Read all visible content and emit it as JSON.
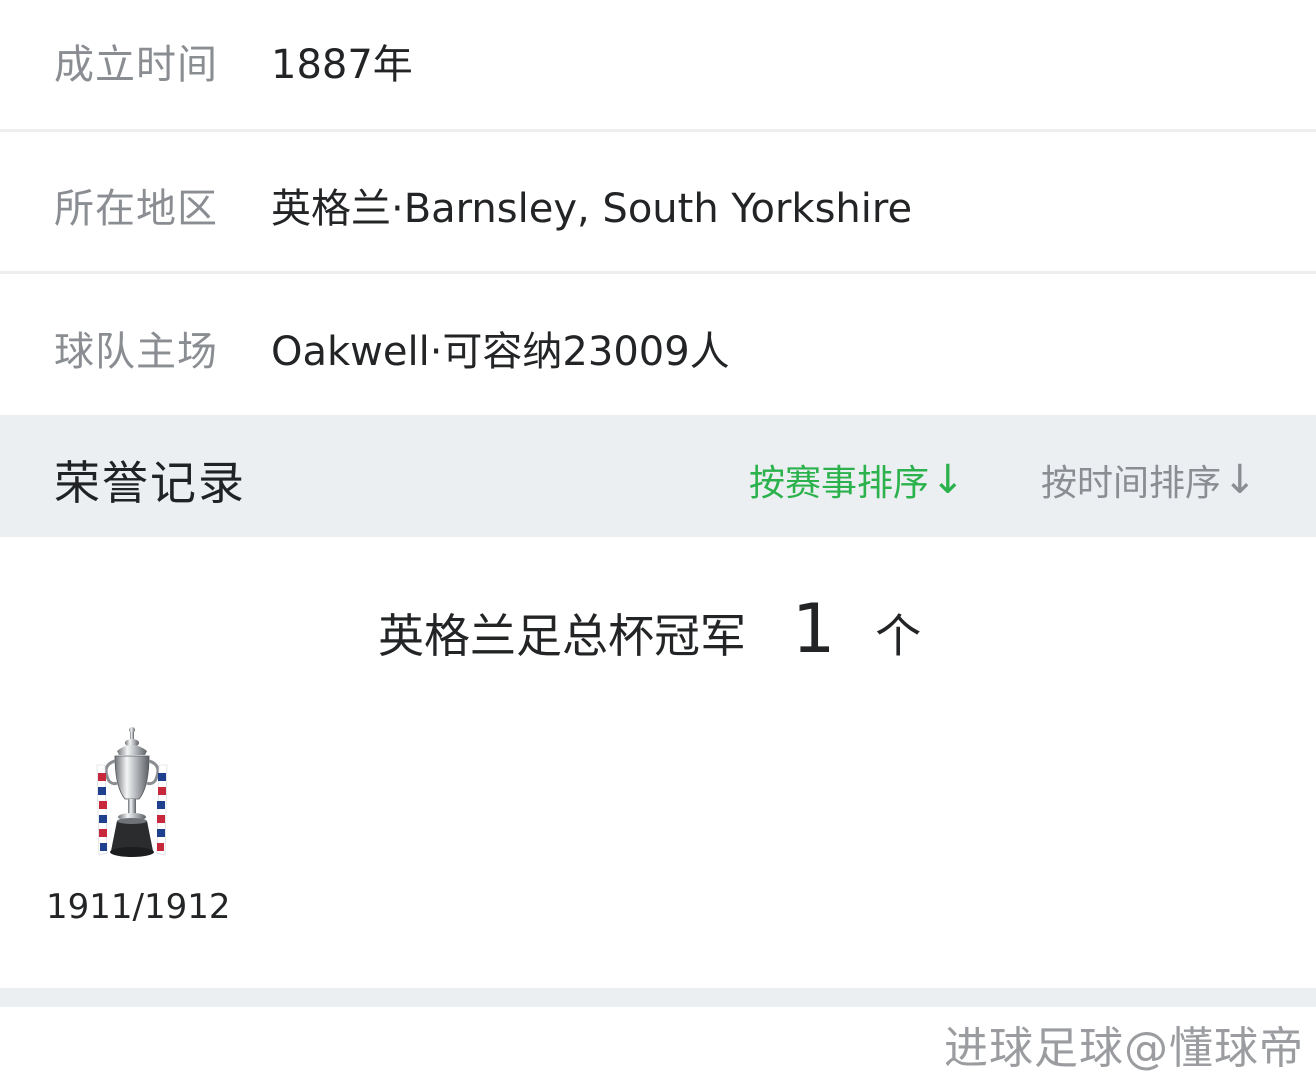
{
  "info": {
    "founded": {
      "label": "成立时间",
      "value": "1887年"
    },
    "region": {
      "label": "所在地区",
      "value": "英格兰·Barnsley, South Yorkshire"
    },
    "stadium": {
      "label": "球队主场",
      "value": "Oakwell·可容纳23009人"
    }
  },
  "honors": {
    "title": "荣誉记录",
    "sort_by_event": "按赛事排序",
    "sort_by_time": "按时间排序",
    "arrow": "↓",
    "active_sort_color": "#2bb24c",
    "competition": "英格兰足总杯冠军",
    "count": "1",
    "unit": "个",
    "items": [
      {
        "season": "1911/1912",
        "icon": "fa-cup-trophy-icon"
      }
    ]
  },
  "watermark": "进球足球@懂球帝"
}
